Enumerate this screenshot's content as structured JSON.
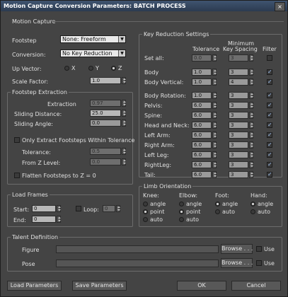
{
  "window": {
    "title": "Motion Capture Conversion Parameters: BATCH PROCESS",
    "close_glyph": "×"
  },
  "motion_capture": {
    "label": "Motion Capture"
  },
  "footstep": {
    "label": "Footstep",
    "value": "None: Freeform"
  },
  "conversion": {
    "label": "Conversion:",
    "value": "No Key Reduction"
  },
  "up_vector": {
    "label": "Up Vector:",
    "x": "X",
    "y": "Y",
    "z": "Z",
    "selected": "Z"
  },
  "scale_factor": {
    "label": "Scale Factor:",
    "value": "1.0"
  },
  "footstep_extraction": {
    "title": "Footstep Extraction",
    "extraction_label": "Extraction",
    "extraction_value": "0.97",
    "sliding_distance_label": "Sliding Distance:",
    "sliding_distance_value": "25.0",
    "sliding_angle_label": "Sliding Angle:",
    "sliding_angle_value": "0.0",
    "only_extract_label": "Only Extract Footsteps Within Tolerance",
    "tolerance_label": "Tolerance:",
    "tolerance_value": "0.5",
    "from_z_label": "From Z Level:",
    "from_z_value": "0.0",
    "flatten_label": "Flatten Footsteps to Z = 0"
  },
  "load_frames": {
    "title": "Load Frames",
    "start_label": "Start:",
    "start_value": "0",
    "end_label": "End:",
    "end_value": "0",
    "loop_label": "Loop:",
    "loop_value": "0"
  },
  "key_reduction": {
    "title": "Key Reduction Settings",
    "col_tolerance": "Tolerance",
    "col_minimum": "Minimum",
    "col_key_spacing": "Key Spacing",
    "col_filter": "Filter",
    "check_glyph": "✓",
    "rows": [
      {
        "label": "Set all:",
        "tolerance": "0.0",
        "spacing": "3",
        "filter": false
      },
      {
        "label": "Body",
        "tolerance": "1.0",
        "spacing": "3",
        "filter": true
      },
      {
        "label": "Body Vertical:",
        "tolerance": "1.0",
        "spacing": "4",
        "filter": true
      },
      {
        "label": "Body Rotation:",
        "tolerance": "1.0",
        "spacing": "3",
        "filter": true
      },
      {
        "label": "Pelvis:",
        "tolerance": "6.0",
        "spacing": "3",
        "filter": true
      },
      {
        "label": "Spine:",
        "tolerance": "6.0",
        "spacing": "3",
        "filter": true
      },
      {
        "label": "Head and Neck:",
        "tolerance": "6.0",
        "spacing": "3",
        "filter": true
      },
      {
        "label": "Left Arm:",
        "tolerance": "6.0",
        "spacing": "3",
        "filter": true
      },
      {
        "label": "Right Arm:",
        "tolerance": "6.0",
        "spacing": "3",
        "filter": true
      },
      {
        "label": "Left Leg:",
        "tolerance": "6.0",
        "spacing": "3",
        "filter": true
      },
      {
        "label": "RightLeg:",
        "tolerance": "6.0",
        "spacing": "3",
        "filter": true
      },
      {
        "label": "Tail:",
        "tolerance": "6.0",
        "spacing": "3",
        "filter": true
      }
    ]
  },
  "limb_orientation": {
    "title": "Limb Orientation",
    "columns": [
      {
        "label": "Knee:",
        "options": [
          "angle",
          "point",
          "auto"
        ],
        "selected": "point"
      },
      {
        "label": "Elbow:",
        "options": [
          "angle",
          "point",
          "auto"
        ],
        "selected": "point"
      },
      {
        "label": "Foot:",
        "options": [
          "angle",
          "auto"
        ],
        "selected": "angle"
      },
      {
        "label": "Hand:",
        "options": [
          "angle",
          "auto"
        ],
        "selected": "angle"
      }
    ]
  },
  "talent_definition": {
    "title": "Talent Definition",
    "figure_label": "Figure",
    "pose_label": "Pose",
    "browse_label": "Browse . . .",
    "use_label": "Use"
  },
  "buttons": {
    "load": "Load Parameters",
    "save": "Save Parameters",
    "ok": "OK",
    "cancel": "Cancel"
  },
  "colors": {
    "background": "#444444",
    "titlebar": "#2c3b50",
    "border": "#6c6c6c",
    "check_accent": "#9ec0f0"
  }
}
